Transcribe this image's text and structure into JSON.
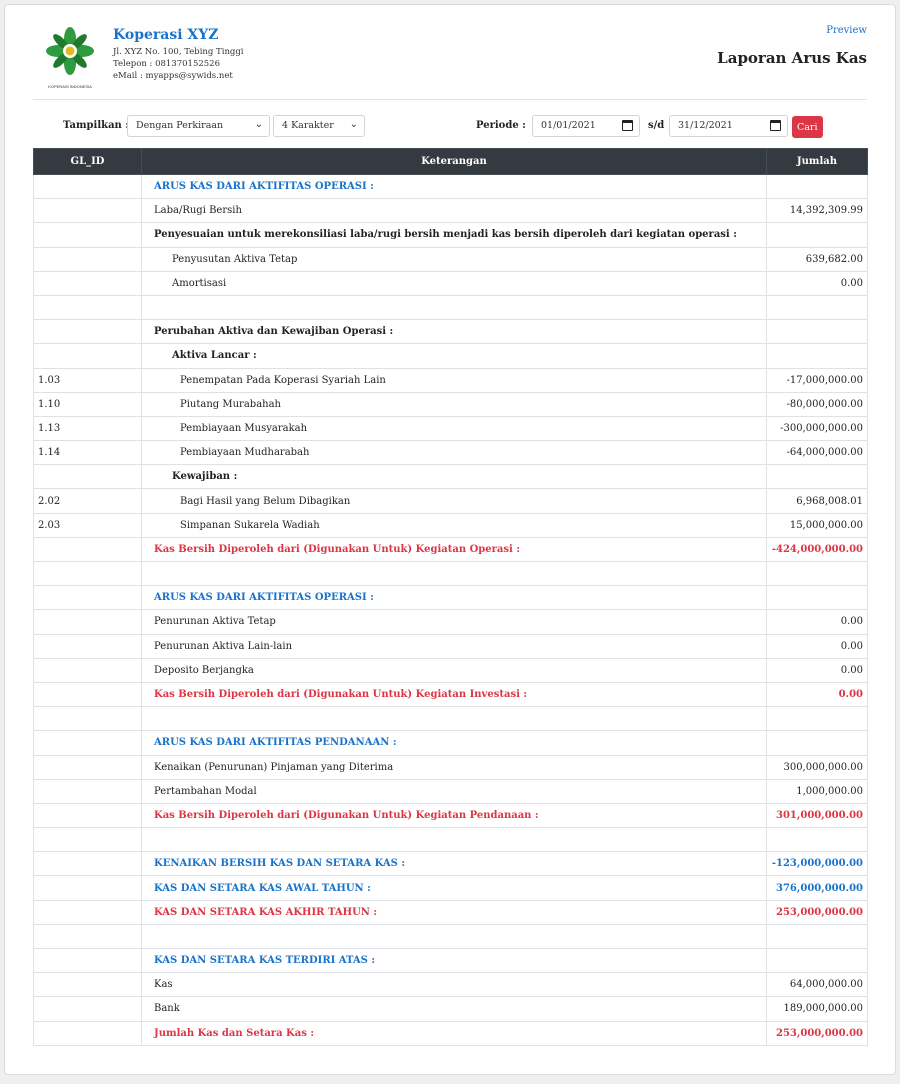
{
  "org": {
    "name": "Koperasi XYZ",
    "address": "Jl. XYZ No. 100, Tebing Tinggi",
    "phone": "Telepon : 081370152526",
    "email": "eMail : myapps@sywids.net",
    "logo_caption": "KOPERASI INDONESIA"
  },
  "header": {
    "preview_label": "Preview",
    "title": "Laporan Arus Kas"
  },
  "filters": {
    "tampilkan_label": "Tampilkan :",
    "mode_value": "Dengan Perkiraan",
    "karakter_value": "4 Karakter",
    "periode_label": "Periode :",
    "date_from": "01/01/2021",
    "sd_label": "s/d",
    "date_to": "31/12/2021",
    "cari_label": "Cari"
  },
  "table": {
    "headers": [
      "GL_ID",
      "Keterangan",
      "Jumlah"
    ],
    "rows": [
      {
        "gl": "",
        "text": "ARUS KAS DARI AKTIFITAS OPERASI :",
        "amt": "",
        "style": "blue",
        "indent": 0
      },
      {
        "gl": "",
        "text": "Laba/Rugi Bersih",
        "amt": "14,392,309.99",
        "style": "",
        "indent": 1
      },
      {
        "gl": "",
        "text": "Penyesuaian untuk merekonsiliasi laba/rugi bersih menjadi kas bersih diperoleh dari kegiatan operasi :",
        "amt": "",
        "style": "bold",
        "indent": 1
      },
      {
        "gl": "",
        "text": "Penyusutan Aktiva Tetap",
        "amt": "639,682.00",
        "style": "",
        "indent": 3
      },
      {
        "gl": "",
        "text": "Amortisasi",
        "amt": "0.00",
        "style": "",
        "indent": 3
      },
      {
        "gl": "",
        "text": "",
        "amt": "",
        "style": "",
        "indent": 0
      },
      {
        "gl": "",
        "text": "Perubahan Aktiva dan Kewajiban Operasi :",
        "amt": "",
        "style": "bold",
        "indent": 1
      },
      {
        "gl": "",
        "text": "Aktiva Lancar :",
        "amt": "",
        "style": "bold",
        "indent": 3
      },
      {
        "gl": "1.03",
        "text": "Penempatan Pada Koperasi Syariah Lain",
        "amt": "-17,000,000.00",
        "style": "",
        "indent": 4
      },
      {
        "gl": "1.10",
        "text": "Piutang Murabahah",
        "amt": "-80,000,000.00",
        "style": "",
        "indent": 4
      },
      {
        "gl": "1.13",
        "text": "Pembiayaan Musyarakah",
        "amt": "-300,000,000.00",
        "style": "",
        "indent": 4
      },
      {
        "gl": "1.14",
        "text": "Pembiayaan Mudharabah",
        "amt": "-64,000,000.00",
        "style": "",
        "indent": 4
      },
      {
        "gl": "",
        "text": "Kewajiban :",
        "amt": "",
        "style": "bold",
        "indent": 3
      },
      {
        "gl": "2.02",
        "text": "Bagi Hasil yang Belum Dibagikan",
        "amt": "6,968,008.01",
        "style": "",
        "indent": 4
      },
      {
        "gl": "2.03",
        "text": "Simpanan Sukarela Wadiah",
        "amt": "15,000,000.00",
        "style": "",
        "indent": 4
      },
      {
        "gl": "",
        "text": "Kas Bersih Diperoleh dari (Digunakan Untuk) Kegiatan Operasi :",
        "amt": "-424,000,000.00",
        "style": "red",
        "indent": 0
      },
      {
        "gl": "",
        "text": "",
        "amt": "",
        "style": "",
        "indent": 0
      },
      {
        "gl": "",
        "text": "ARUS KAS DARI AKTIFITAS OPERASI :",
        "amt": "",
        "style": "blue",
        "indent": 0
      },
      {
        "gl": "",
        "text": "Penurunan Aktiva Tetap",
        "amt": "0.00",
        "style": "",
        "indent": 1
      },
      {
        "gl": "",
        "text": "Penurunan Aktiva Lain-lain",
        "amt": "0.00",
        "style": "",
        "indent": 1
      },
      {
        "gl": "",
        "text": "Deposito Berjangka",
        "amt": "0.00",
        "style": "",
        "indent": 1
      },
      {
        "gl": "",
        "text": "Kas Bersih Diperoleh dari (Digunakan Untuk) Kegiatan Investasi :",
        "amt": "0.00",
        "style": "red",
        "indent": 0
      },
      {
        "gl": "",
        "text": "",
        "amt": "",
        "style": "",
        "indent": 0
      },
      {
        "gl": "",
        "text": "ARUS KAS DARI AKTIFITAS PENDANAAN :",
        "amt": "",
        "style": "blue",
        "indent": 0
      },
      {
        "gl": "",
        "text": "Kenaikan (Penurunan) Pinjaman yang Diterima",
        "amt": "300,000,000.00",
        "style": "",
        "indent": 1
      },
      {
        "gl": "",
        "text": "Pertambahan Modal",
        "amt": "1,000,000.00",
        "style": "",
        "indent": 1
      },
      {
        "gl": "",
        "text": "Kas Bersih Diperoleh dari (Digunakan Untuk) Kegiatan Pendanaan :",
        "amt": "301,000,000.00",
        "style": "red",
        "indent": 0
      },
      {
        "gl": "",
        "text": "",
        "amt": "",
        "style": "",
        "indent": 0
      },
      {
        "gl": "",
        "text": "KENAIKAN BERSIH KAS DAN SETARA KAS :",
        "amt": "-123,000,000.00",
        "style": "blue",
        "indent": 0
      },
      {
        "gl": "",
        "text": "KAS DAN SETARA KAS AWAL TAHUN :",
        "amt": "376,000,000.00",
        "style": "blue",
        "indent": 0
      },
      {
        "gl": "",
        "text": "KAS DAN SETARA KAS AKHIR TAHUN :",
        "amt": "253,000,000.00",
        "style": "red",
        "indent": 0
      },
      {
        "gl": "",
        "text": "",
        "amt": "",
        "style": "",
        "indent": 0
      },
      {
        "gl": "",
        "text": "KAS DAN SETARA KAS TERDIRI ATAS :",
        "amt": "",
        "style": "blue",
        "indent": 0
      },
      {
        "gl": "",
        "text": "Kas",
        "amt": "64,000,000.00",
        "style": "",
        "indent": 1
      },
      {
        "gl": "",
        "text": "Bank",
        "amt": "189,000,000.00",
        "style": "",
        "indent": 1
      },
      {
        "gl": "",
        "text": "Jumlah Kas dan Setara Kas :",
        "amt": "253,000,000.00",
        "style": "red",
        "indent": 0
      }
    ]
  }
}
